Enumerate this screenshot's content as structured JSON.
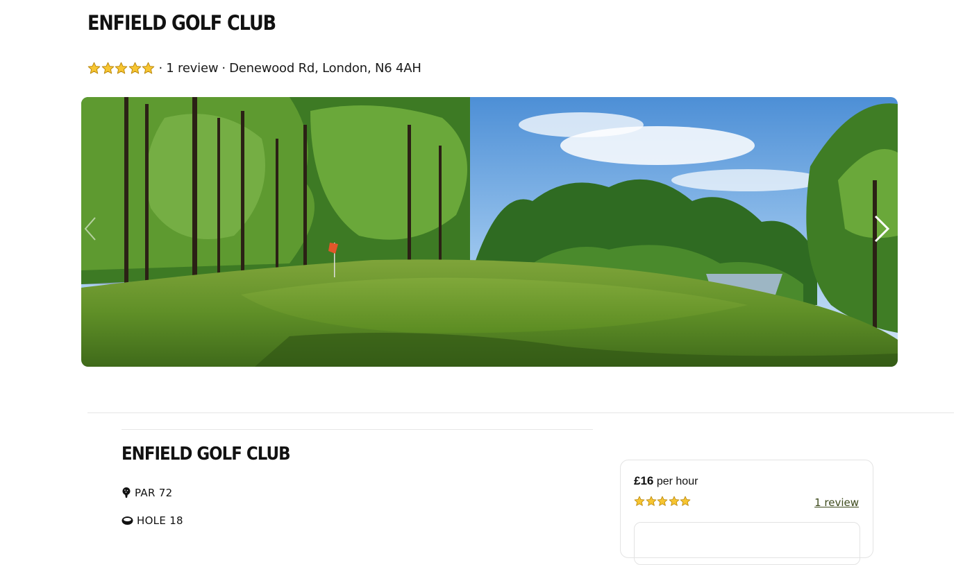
{
  "header": {
    "title": "ENFIELD GOLF CLUB",
    "rating_stars": 5,
    "separator": "·",
    "review_count_text": "1 review",
    "address": "Denewood Rd, London, N6 4AH"
  },
  "gallery": {
    "prev_icon": "chevron-left-icon",
    "next_icon": "chevron-right-icon"
  },
  "details": {
    "title": "ENFIELD GOLF CLUB",
    "par_icon": "golf-tee-icon",
    "par_label": "PAR 72",
    "hole_icon": "golf-hole-icon",
    "hole_label": "HOLE 18"
  },
  "booking_card": {
    "price": "£16",
    "price_unit": "per hour",
    "rating_stars": 5,
    "review_link": "1 review"
  },
  "colors": {
    "star_fill": "#f7c531",
    "star_outline": "#b8860b",
    "link": "#3d4a1c",
    "divider": "#e6e6e6"
  }
}
